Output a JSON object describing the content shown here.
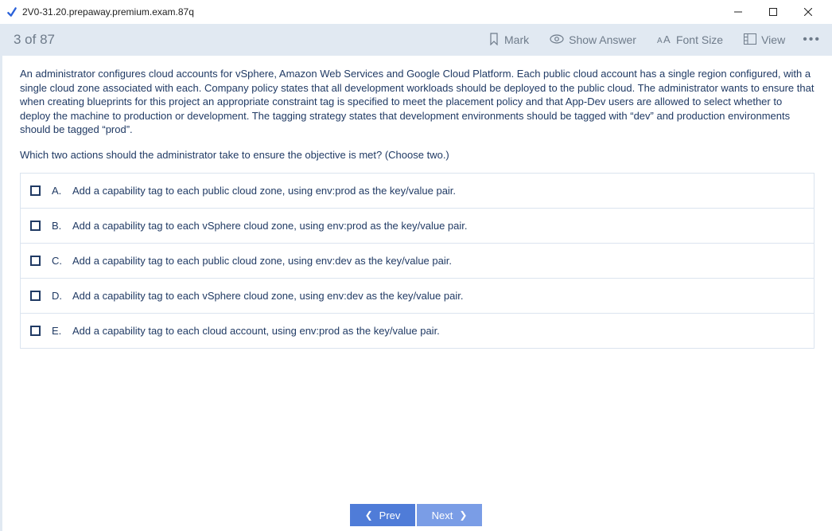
{
  "window": {
    "title": "2V0-31.20.prepaway.premium.exam.87q"
  },
  "toolbar": {
    "counter": "3 of 87",
    "mark": "Mark",
    "show_answer": "Show Answer",
    "font_size": "Font Size",
    "view": "View"
  },
  "question": {
    "para1": "An administrator configures cloud accounts for vSphere, Amazon Web Services and Google Cloud Platform. Each public cloud account has a single region configured, with a single cloud zone associated with each. Company policy states that all development workloads should be deployed to the public cloud. The administrator wants to ensure that when creating blueprints for this project an appropriate constraint tag is specified to meet the placement policy and that App-Dev users are allowed to select whether to deploy the machine to production or development. The tagging strategy states that development environments should be tagged with “dev” and production environments should be tagged “prod”.",
    "para2": "Which two actions should the administrator take to ensure the objective is met? (Choose two.)"
  },
  "options": [
    {
      "letter": "A.",
      "text": "Add a capability tag to each public cloud zone, using env:prod as the key/value pair."
    },
    {
      "letter": "B.",
      "text": "Add a capability tag to each vSphere cloud zone, using env:prod as the key/value pair."
    },
    {
      "letter": "C.",
      "text": "Add a capability tag to each public cloud zone, using env:dev as the key/value pair."
    },
    {
      "letter": "D.",
      "text": "Add a capability tag to each vSphere cloud zone, using env:dev as the key/value pair."
    },
    {
      "letter": "E.",
      "text": "Add a capability tag to each cloud account, using env:prod as the key/value pair."
    }
  ],
  "footer": {
    "prev": "Prev",
    "next": "Next"
  }
}
